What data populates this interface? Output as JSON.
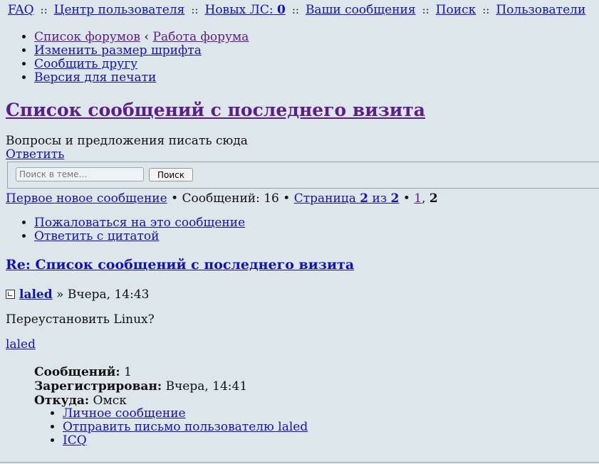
{
  "topnav": {
    "faq": "FAQ",
    "sep": "::",
    "ucp": "Центр пользователя",
    "new_pm_label": "Новых ЛС:",
    "new_pm_count": "0",
    "your_posts": "Ваши сообщения",
    "search": "Поиск",
    "members": "Пользователи"
  },
  "crumbs": {
    "forum_index": "Список форумов",
    "arrow": "‹",
    "forum": "Работа форума",
    "font_size": "Изменить размер шрифта",
    "email_friend": "Сообщить другу",
    "print": "Версия для печати"
  },
  "topic": {
    "title": "Список сообщений с последнего визита",
    "description": "Вопросы и предложения писать сюда",
    "reply": "Ответить"
  },
  "search": {
    "placeholder": "Поиск в теме…",
    "button": "Поиск"
  },
  "pagination": {
    "first_unread": "Первое новое сообщение",
    "bullet": "•",
    "posts_label": "Сообщений:",
    "posts_count": "16",
    "page_word": "Страница",
    "current_page": "2",
    "of_word": "из",
    "total_pages": "2",
    "page_1": "1",
    "comma": ",",
    "page_2": "2"
  },
  "post_actions": {
    "report": "Пожаловаться на это сообщение",
    "quote": "Ответить с цитатой"
  },
  "post": {
    "title": "Re: Список сообщений с последнего визита",
    "author": "laled",
    "sep": "»",
    "time": "Вчера, 14:43",
    "content": "Переустановить Linux?"
  },
  "profile": {
    "username": "laled",
    "posts_label": "Сообщений:",
    "posts_value": "1",
    "joined_label": "Зарегистрирован:",
    "joined_value": "Вчера, 14:41",
    "from_label": "Откуда:",
    "from_value": "Омск",
    "pm": "Личное сообщение",
    "email": "Отправить письмо пользователю laled",
    "icq": "ICQ"
  }
}
